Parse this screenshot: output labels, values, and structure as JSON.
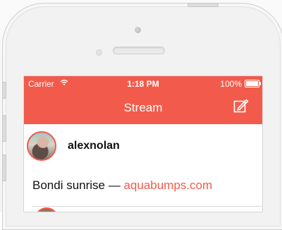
{
  "status_bar": {
    "carrier": "Carrier",
    "time": "1:18 PM",
    "battery": "100%"
  },
  "nav": {
    "title": "Stream",
    "compose_icon": "compose-icon"
  },
  "posts": [
    {
      "username": "alexnolan",
      "text": "Bondi sunrise — ",
      "link": "aquabumps.com"
    }
  ],
  "colors": {
    "accent": "#f25b4b",
    "text": "#111111"
  }
}
